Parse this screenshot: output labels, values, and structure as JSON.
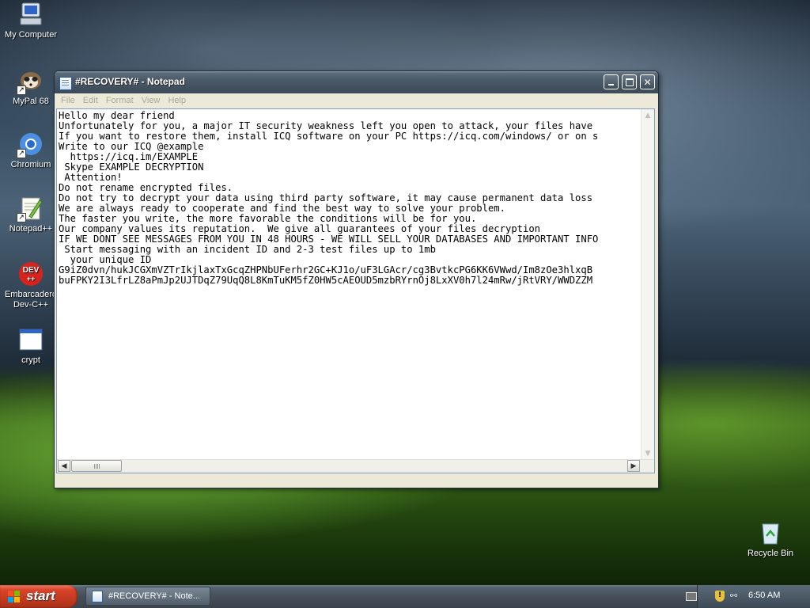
{
  "desktop": {
    "icons": [
      {
        "label": "My Computer"
      },
      {
        "label": "MyPal 68"
      },
      {
        "label": "Chromium"
      },
      {
        "label": "Notepad++"
      },
      {
        "label": "Embarcadero Dev-C++",
        "logo_text": "DEV"
      },
      {
        "label": "crypt"
      },
      {
        "label": "Recycle Bin"
      }
    ]
  },
  "window": {
    "title": "#RECOVERY# - Notepad",
    "menu": [
      "File",
      "Edit",
      "Format",
      "View",
      "Help"
    ],
    "content": "Hello my dear friend\nUnfortunately for you, a major IT security weakness left you open to attack, your files have\nIf you want to restore them, install ICQ software on your PC https://icq.com/windows/ or on s\nWrite to our ICQ @example\n  https://icq.im/EXAMPLE\n Skype EXAMPLE DECRYPTION\n Attention!\nDo not rename encrypted files.\nDo not try to decrypt your data using third party software, it may cause permanent data loss\nWe are always ready to cooperate and find the best way to solve your problem.\nThe faster you write, the more favorable the conditions will be for you.\nOur company values its reputation.  We give all guarantees of your files decryption\nIF WE DONT SEE MESSAGES FROM YOU IN 48 HOURS - WE WILL SELL YOUR DATABASES AND IMPORTANT INFO\n Start messaging with an incident ID and 2-3 test files up to 1mb\n  your unique ID\nG9iZ0dvn/hukJCGXmVZTrIkjlaxTxGcqZHPNbUFerhr2GC+KJ1o/uF3LGAcr/cg3BvtkcPG6KK6VWwd/Im8zOe3hlxqB\nbuFPKY2I3LfrLZ8aPmJp2UJTDqZ79UqQ8L8KmTuKM5fZ0HW5cAEOUD5mzbRYrnOj8LxXV0h7l24mRw/jRtVRY/WWDZZM"
  },
  "taskbar": {
    "start_label": "start",
    "task_label": "#RECOVERY# - Note...",
    "clock": "6:50 AM"
  }
}
